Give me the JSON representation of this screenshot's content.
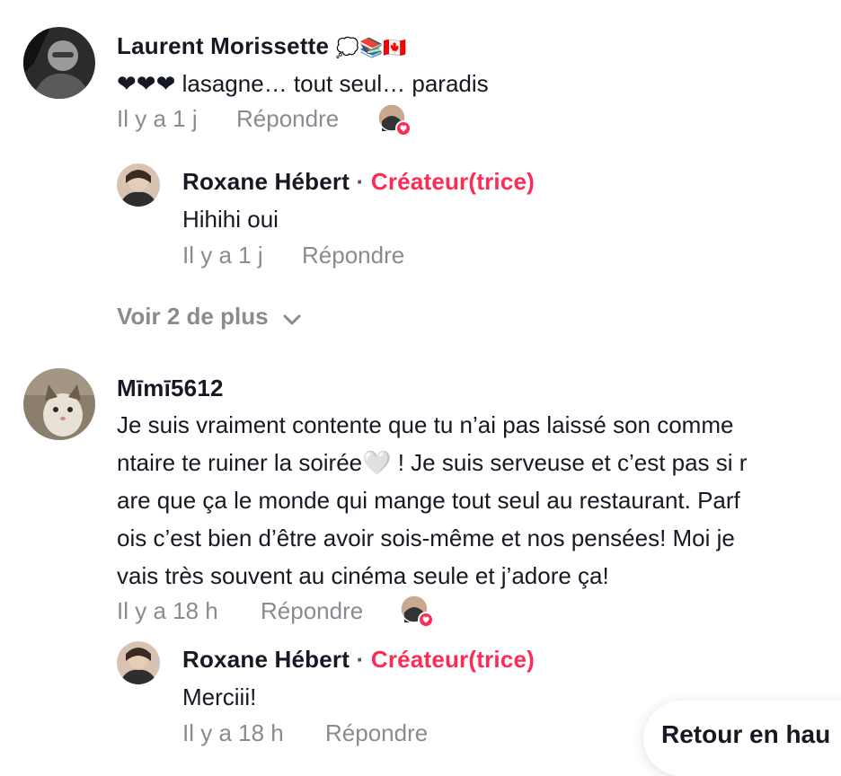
{
  "comments": [
    {
      "author": "Laurent Morissette",
      "author_emojis": "💭📚🇨🇦",
      "text_lines": [
        "❤❤❤ lasagne… tout seul… paradis"
      ],
      "time": "Il y a 1 j",
      "reply_label": "Répondre",
      "replies": [
        {
          "author": "Roxane Hébert",
          "separator": "·",
          "badge": "Créateur(trice)",
          "text_lines": [
            "Hihihi oui"
          ],
          "time": "Il y a 1 j",
          "reply_label": "Répondre"
        }
      ],
      "more_label": "Voir 2 de plus"
    },
    {
      "author": "Mīmī5612",
      "text_lines": [
        "Je suis vraiment contente que tu n’ai pas laissé son comme",
        "ntaire te ruiner la soirée🤍 ! Je suis serveuse et c’est pas si r",
        "are que ça le monde qui mange tout seul au restaurant. Parf",
        "ois c’est bien d’être avoir sois-même et nos pensées! Moi je",
        "vais très souvent au cinéma seule et j’adore ça!"
      ],
      "time": "Il y a 18 h",
      "reply_label": "Répondre",
      "replies": [
        {
          "author": "Roxane Hébert",
          "separator": "·",
          "badge": "Créateur(trice)",
          "text_lines": [
            "Merciii!"
          ],
          "time": "Il y a 18 h",
          "reply_label": "Répondre"
        }
      ]
    }
  ],
  "back_to_top_label": "Retour en hau",
  "colors": {
    "creator_accent": "#fe2c55",
    "muted_text": "#8a8b91",
    "primary_text": "#161823"
  }
}
